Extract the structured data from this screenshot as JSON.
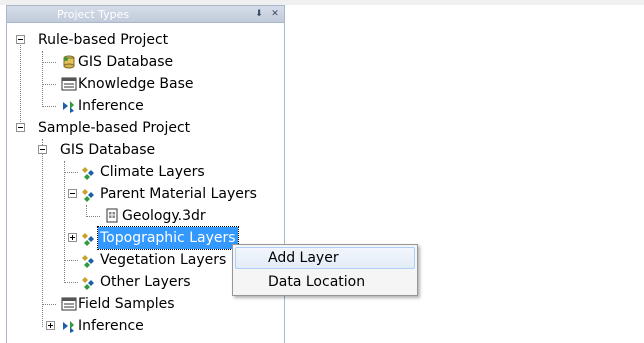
{
  "panel": {
    "title": "Project Types",
    "pin_glyph": "⬇",
    "close_glyph": "✕"
  },
  "tree": {
    "rule_project": "Rule-based Project",
    "rule_gis_db": "GIS Database",
    "rule_kb": "Knowledge Base",
    "rule_inference": "Inference",
    "sample_project": "Sample-based Project",
    "sample_gis_db": "GIS Database",
    "climate": "Climate Layers",
    "parent_material": "Parent Material Layers",
    "geology": "Geology.3dr",
    "topographic": "Topographic Layers",
    "vegetation": "Vegetation Layers",
    "other": "Other Layers",
    "field_samples": "Field Samples",
    "sample_inference": "Inference"
  },
  "context_menu": {
    "items": [
      "Add Layer",
      "Data Location"
    ]
  },
  "colors": {
    "selection": "#3399ff",
    "menu_hover_border": "#aecff7",
    "tree_lines": "#808080"
  },
  "icons": [
    "database-icon",
    "knowledge-base-icon",
    "inference-icon",
    "layer-group-icon",
    "raster-file-icon",
    "field-samples-icon"
  ]
}
